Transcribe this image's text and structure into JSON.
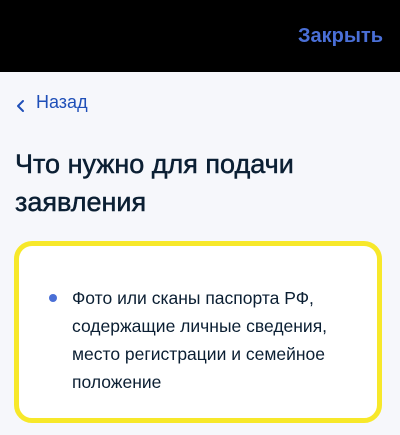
{
  "header": {
    "close_label": "Закрыть"
  },
  "nav": {
    "back_label": "Назад"
  },
  "page": {
    "title": "Что нужно для подачи заявления"
  },
  "documents": [
    {
      "text": "Фото или сканы паспорта РФ, содержащие личные сведения, место регистрации и семейное положение"
    }
  ],
  "colors": {
    "accent": "#4a6fd6",
    "link": "#1f4fb8",
    "highlight_border": "#f7e82a",
    "text": "#0b1f33",
    "topbar": "#000000"
  },
  "icons": {
    "back": "chevron-left-icon",
    "bullet": "bullet-dot-icon"
  }
}
